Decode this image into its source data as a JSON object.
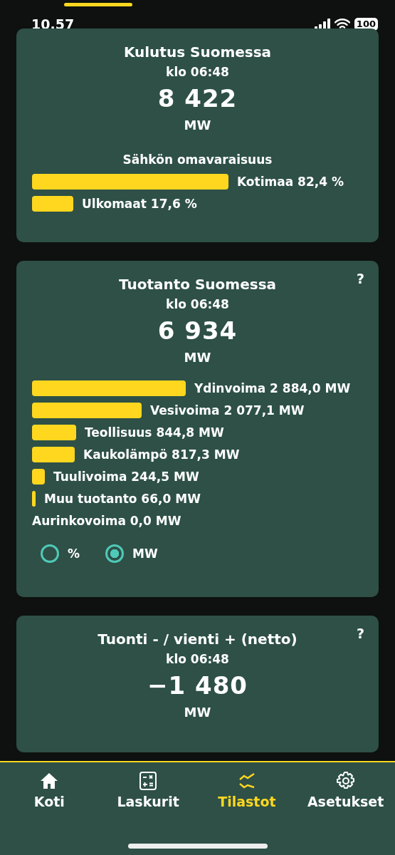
{
  "status_bar": {
    "time": "10.57",
    "battery": "100"
  },
  "consumption": {
    "title": "Kulutus Suomessa",
    "time": "klo 06:48",
    "value": "8 422",
    "unit": "MW",
    "subtitle": "Sähkön omavaraisuus",
    "bars": [
      {
        "label": "Kotimaa 82,4 %"
      },
      {
        "label": "Ulkomaat 17,6 %"
      }
    ]
  },
  "production": {
    "title": "Tuotanto Suomessa",
    "help": "?",
    "time": "klo 06:48",
    "value": "6 934",
    "unit": "MW",
    "bars": [
      {
        "label": "Ydinvoima 2 884,0 MW"
      },
      {
        "label": "Vesivoima 2 077,1 MW"
      },
      {
        "label": "Teollisuus 844,8 MW"
      },
      {
        "label": "Kaukolämpö 817,3 MW"
      },
      {
        "label": "Tuulivoima 244,5 MW"
      },
      {
        "label": "Muu tuotanto 66,0 MW"
      },
      {
        "label": "Aurinkovoima 0,0 MW"
      }
    ],
    "units": [
      {
        "label": "%",
        "selected": false
      },
      {
        "label": "MW",
        "selected": true
      }
    ]
  },
  "net": {
    "title": "Tuonti - / vienti + (netto)",
    "help": "?",
    "time": "klo 06:48",
    "value": "−1 480",
    "unit": "MW"
  },
  "tab_bar": [
    {
      "label": "Koti",
      "selected": false
    },
    {
      "label": "Laskurit",
      "selected": false
    },
    {
      "label": "Tilastot",
      "selected": true
    },
    {
      "label": "Asetukset",
      "selected": false
    }
  ]
}
